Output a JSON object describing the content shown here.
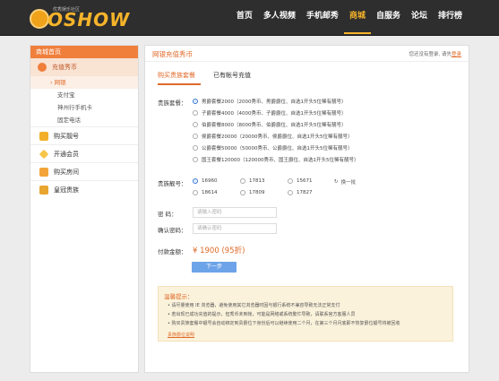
{
  "header": {
    "logo_text": "OSHOW",
    "logo_sub": "优秀娱乐社区",
    "nav": [
      {
        "label": "首页",
        "active": false
      },
      {
        "label": "多人视频",
        "active": false
      },
      {
        "label": "手机邮秀",
        "active": false
      },
      {
        "label": "商城",
        "active": true
      },
      {
        "label": "自服务",
        "active": false
      },
      {
        "label": "论坛",
        "active": false
      },
      {
        "label": "排行榜",
        "active": false
      }
    ]
  },
  "sidebar": {
    "home": "商城首页",
    "section": "充值秀币",
    "subitems": [
      "网银",
      "支付宝",
      "神州行手机卡",
      "固定电话"
    ],
    "items": [
      "购买靓号",
      "开通会员",
      "购买房间",
      "皇冠贵族"
    ]
  },
  "main": {
    "title": "网银充值秀币",
    "login_tip": "您还没有登录, 请先",
    "login_link": "登录",
    "tabs": [
      "购买贵族套餐",
      "已有帐号充值"
    ],
    "package_label": "贵族套餐：",
    "packages": [
      "男爵套餐2000（2000秀币、男爵爵位、自选1开头5位稀有靓号）",
      "子爵套餐4000（4000秀币、子爵爵位、自选1开头5位稀有靓号）",
      "伯爵套餐8000（8000秀币、伯爵爵位、自选1开头5位稀有靓号）",
      "侯爵套餐20000（20000秀币、侯爵爵位、自选1开头5位稀有靓号）",
      "公爵套餐50000（50000秀币、公爵爵位、自选1开头5位稀有靓号）",
      "国王套餐120000（120000秀币、国王爵位、自选1开头5位稀有靓号）"
    ],
    "account_label": "贵族靓号：",
    "accounts": [
      "16960",
      "17813",
      "15671",
      "18614",
      "17809",
      "17827"
    ],
    "refresh": "换一批",
    "password_label": "密    码：",
    "password_placeholder": "请输入密码",
    "confirm_label": "确认密码：",
    "confirm_placeholder": "请确认密码",
    "amount_label": "付款金额：",
    "amount": "¥ 1900 (95折)",
    "next_button": "下一步",
    "notice": {
      "title": "温馨提示：",
      "lines": [
        "• 请尽量使用 IE 浏览器，避免使用其它浏览器时因与银行系统不兼容导致无法正常支付",
        "• 若出现已成功充值的提示，但秀币未到帐，可能是网络或系统繁忙导致，请联系官方客服人员",
        "• 购买贵族套餐中靓号会自动绑定到贵爵位下身份后可以继续使用二个月，在第三个月月底即不恢复爵位靓号将被回收"
      ],
      "link": "贵族爵位说明"
    }
  },
  "colors": {
    "accent": "#e06a28",
    "topbar": "#2e2e2e",
    "button": "#6da3e8"
  }
}
